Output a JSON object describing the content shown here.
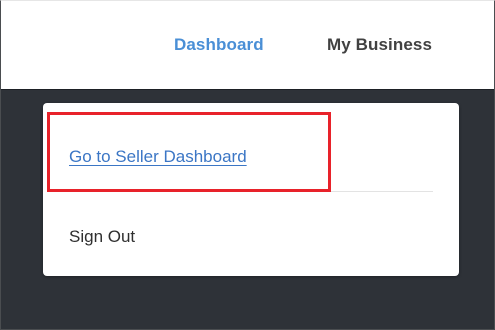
{
  "nav": {
    "dashboard": "Dashboard",
    "my_business": "My Business"
  },
  "dropdown": {
    "seller_dashboard": "Go to Seller Dashboard",
    "sign_out": "Sign Out"
  },
  "colors": {
    "active_nav": "#4a8fd6",
    "link": "#3b76c5",
    "highlight": "#e8222a",
    "backdrop": "#2e3238"
  }
}
